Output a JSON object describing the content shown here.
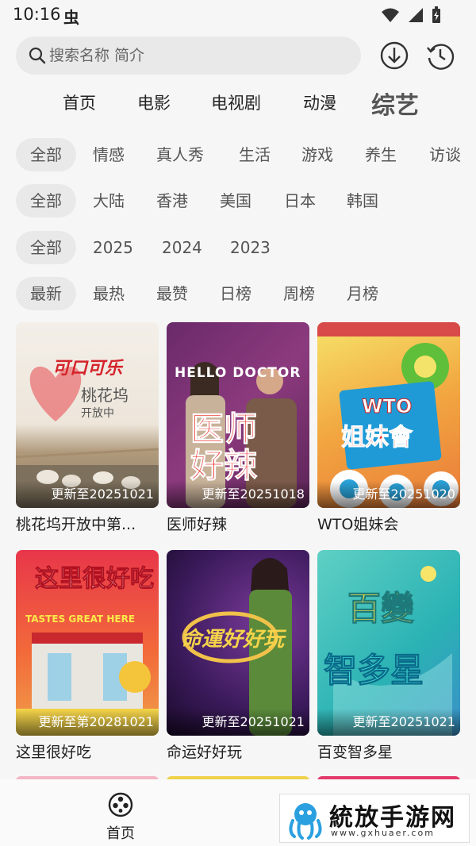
{
  "status_bar": {
    "time": "10:16",
    "notif_glyph": "虫"
  },
  "search": {
    "placeholder": "搜索名称 简介"
  },
  "main_tabs": [
    "首页",
    "电影",
    "电视剧",
    "动漫",
    "综艺"
  ],
  "filters": {
    "genre": [
      "全部",
      "情感",
      "真人秀",
      "生活",
      "游戏",
      "养生",
      "访谈"
    ],
    "region": [
      "全部",
      "大陆",
      "香港",
      "美国",
      "日本",
      "韩国"
    ],
    "year": [
      "全部",
      "2025",
      "2024",
      "2023"
    ],
    "sort": [
      "最新",
      "最热",
      "最赞",
      "日榜",
      "周榜",
      "月榜"
    ]
  },
  "cards": [
    {
      "title": "桃花坞开放中第...",
      "update": "更新至20251021",
      "poster_text": "可口可乐",
      "poster_sub": "桃花坞",
      "poster_sub2": "开放中"
    },
    {
      "title": "医师好辣",
      "update": "更新至20251018",
      "poster_text": "HELLO DOCTOR",
      "poster_sub": "医师好辣"
    },
    {
      "title": "WTO姐妹会",
      "update": "更新至20251020",
      "poster_text": "WTO",
      "poster_sub": "姐妹會"
    },
    {
      "title": "这里很好吃",
      "update": "更新至第20281021",
      "poster_text": "这里很好吃",
      "poster_sub": "TASTES GREAT HERE"
    },
    {
      "title": "命运好好玩",
      "update": "更新至20251021",
      "poster_text": "命運好好玩"
    },
    {
      "title": "百变智多星",
      "update": "更新至20251021",
      "poster_text": "百變",
      "poster_sub": "智多星"
    }
  ],
  "bottom_nav": {
    "home_label": "首页"
  },
  "watermark": {
    "text": "統放手游网",
    "url": "www.gxhuaer.com"
  },
  "colors": {
    "background": "#f6f6f6",
    "chip_bg": "#e9e9e9",
    "active_tab": "#555555"
  }
}
